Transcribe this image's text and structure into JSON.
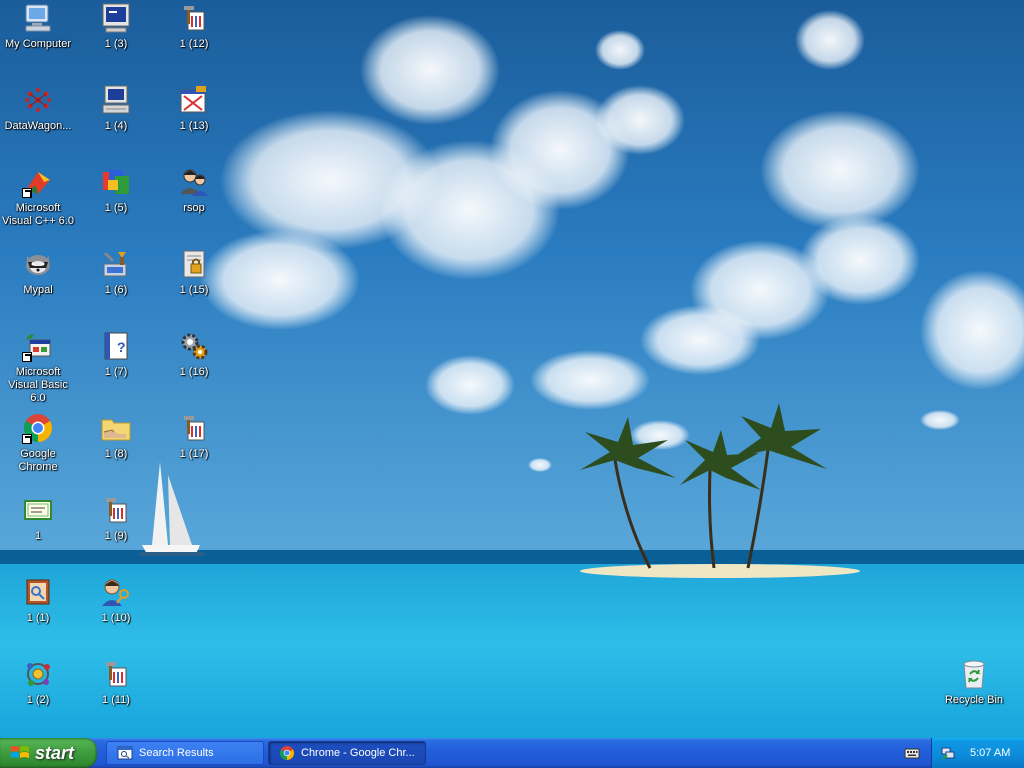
{
  "desktop": {
    "icons": [
      {
        "label": "My Computer",
        "icon": "my-computer-icon",
        "shortcut": false
      },
      {
        "label": "DataWagon...",
        "icon": "datawagon-icon",
        "shortcut": false
      },
      {
        "label": "Microsoft Visual C++ 6.0",
        "icon": "visual-cpp-icon",
        "shortcut": true
      },
      {
        "label": "Mypal",
        "icon": "mypal-icon",
        "shortcut": false
      },
      {
        "label": "Microsoft Visual Basic 6.0",
        "icon": "visual-basic-icon",
        "shortcut": true
      },
      {
        "label": "Google Chrome",
        "icon": "chrome-icon",
        "shortcut": true
      },
      {
        "label": "1",
        "icon": "certificate-icon",
        "shortcut": false
      },
      {
        "label": "1 (1)",
        "icon": "file-icon",
        "shortcut": false
      },
      {
        "label": "1 (2)",
        "icon": "network-icon",
        "shortcut": false
      },
      {
        "label": "1 (3)",
        "icon": "computer-icon",
        "shortcut": false
      },
      {
        "label": "1 (4)",
        "icon": "computer-icon",
        "shortcut": false
      },
      {
        "label": "1 (5)",
        "icon": "installer-icon",
        "shortcut": false
      },
      {
        "label": "1 (6)",
        "icon": "tools-icon",
        "shortcut": false
      },
      {
        "label": "1 (7)",
        "icon": "help-file-icon",
        "shortcut": false
      },
      {
        "label": "1 (8)",
        "icon": "shared-folder-icon",
        "shortcut": false
      },
      {
        "label": "1 (9)",
        "icon": "tool-icon",
        "shortcut": false
      },
      {
        "label": "1 (10)",
        "icon": "user-key-icon",
        "shortcut": false
      },
      {
        "label": "1 (11)",
        "icon": "tool-icon",
        "shortcut": false
      },
      {
        "label": "1 (12)",
        "icon": "tool-icon",
        "shortcut": false
      },
      {
        "label": "1 (13)",
        "icon": "window-edit-icon",
        "shortcut": false
      },
      {
        "label": "rsop",
        "icon": "users-icon",
        "shortcut": false
      },
      {
        "label": "1 (15)",
        "icon": "secure-file-icon",
        "shortcut": false
      },
      {
        "label": "1 (16)",
        "icon": "gears-icon",
        "shortcut": false
      },
      {
        "label": "1 (17)",
        "icon": "tool-icon",
        "shortcut": false
      },
      {
        "label": "Recycle Bin",
        "icon": "recycle-bin-icon",
        "shortcut": false
      }
    ]
  },
  "taskbar": {
    "start_label": "start",
    "tasks": [
      {
        "label": "Search Results",
        "icon": "search-results-icon"
      },
      {
        "label": "Chrome - Google Chr...",
        "icon": "chrome-icon"
      }
    ],
    "clock": "5:07 AM"
  }
}
